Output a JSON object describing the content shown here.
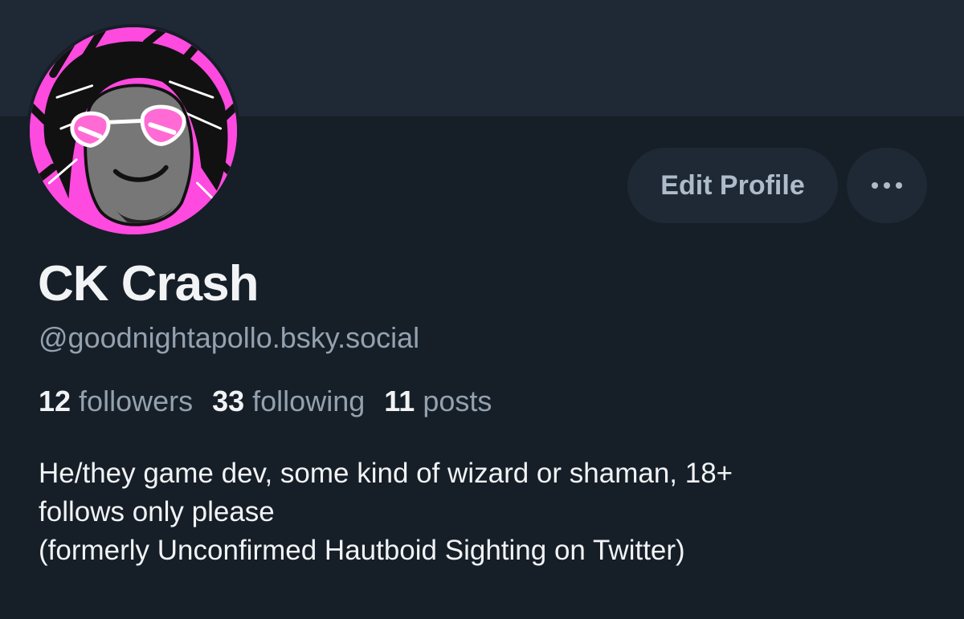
{
  "profile": {
    "display_name": "CK Crash",
    "handle": "@goodnightapollo.bsky.social",
    "avatar_icon": "cartoon-avatar-pink-heart-glasses",
    "stats": {
      "followers_count": "12",
      "followers_label": " followers",
      "following_count": "33",
      "following_label": " following",
      "posts_count": "11",
      "posts_label": " posts"
    },
    "bio_lines": [
      "He/they game dev, some kind of wizard or shaman, 18+",
      "follows only please",
      "(formerly Unconfirmed Hautboid Sighting on Twitter)"
    ]
  },
  "actions": {
    "edit_profile_label": "Edit Profile",
    "more_icon": "ellipsis-icon"
  },
  "colors": {
    "background": "#161e27",
    "banner": "#1e2935",
    "button_bg": "#1e2935",
    "muted_text": "#93a1b0",
    "avatar_bg": "#ff4ae0"
  }
}
